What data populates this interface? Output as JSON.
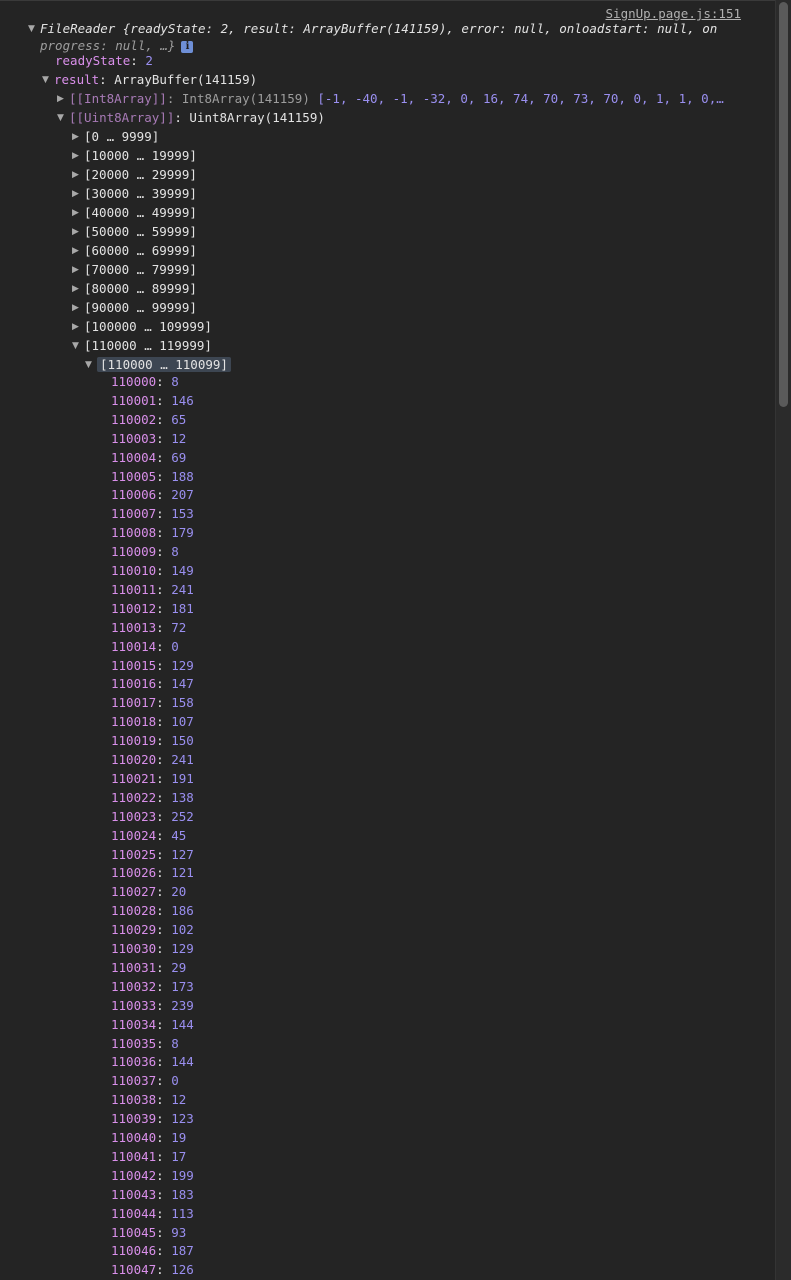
{
  "source_link": "SignUp.page.js:151",
  "filereader": {
    "line1": "FileReader {readyState: 2, result: ArrayBuffer(141159), error: null, onloadstart: null, on",
    "line2": "progress: null, …}",
    "info_icon": "i"
  },
  "ready_state": {
    "key": "readyState",
    "value": "2"
  },
  "result": {
    "key": "result",
    "value": "ArrayBuffer(141159)"
  },
  "int8": {
    "key": "[[Int8Array]]",
    "type": "Int8Array(141159)",
    "preview": "[-1, -40, -1, -32, 0, 16, 74, 70, 73, 70, 0, 1, 1, 0,…"
  },
  "uint8": {
    "key": "[[Uint8Array]]",
    "type": "Uint8Array(141159)"
  },
  "ranges": [
    "[0 … 9999]",
    "[10000 … 19999]",
    "[20000 … 29999]",
    "[30000 … 39999]",
    "[40000 … 49999]",
    "[50000 … 59999]",
    "[60000 … 69999]",
    "[70000 … 79999]",
    "[80000 … 89999]",
    "[90000 … 99999]",
    "[100000 … 109999]",
    "[110000 … 119999]"
  ],
  "subrange": "[110000 … 110099]",
  "entries": [
    {
      "index": "110000",
      "value": "8"
    },
    {
      "index": "110001",
      "value": "146"
    },
    {
      "index": "110002",
      "value": "65"
    },
    {
      "index": "110003",
      "value": "12"
    },
    {
      "index": "110004",
      "value": "69"
    },
    {
      "index": "110005",
      "value": "188"
    },
    {
      "index": "110006",
      "value": "207"
    },
    {
      "index": "110007",
      "value": "153"
    },
    {
      "index": "110008",
      "value": "179"
    },
    {
      "index": "110009",
      "value": "8"
    },
    {
      "index": "110010",
      "value": "149"
    },
    {
      "index": "110011",
      "value": "241"
    },
    {
      "index": "110012",
      "value": "181"
    },
    {
      "index": "110013",
      "value": "72"
    },
    {
      "index": "110014",
      "value": "0"
    },
    {
      "index": "110015",
      "value": "129"
    },
    {
      "index": "110016",
      "value": "147"
    },
    {
      "index": "110017",
      "value": "158"
    },
    {
      "index": "110018",
      "value": "107"
    },
    {
      "index": "110019",
      "value": "150"
    },
    {
      "index": "110020",
      "value": "241"
    },
    {
      "index": "110021",
      "value": "191"
    },
    {
      "index": "110022",
      "value": "138"
    },
    {
      "index": "110023",
      "value": "252"
    },
    {
      "index": "110024",
      "value": "45"
    },
    {
      "index": "110025",
      "value": "127"
    },
    {
      "index": "110026",
      "value": "121"
    },
    {
      "index": "110027",
      "value": "20"
    },
    {
      "index": "110028",
      "value": "186"
    },
    {
      "index": "110029",
      "value": "102"
    },
    {
      "index": "110030",
      "value": "129"
    },
    {
      "index": "110031",
      "value": "29"
    },
    {
      "index": "110032",
      "value": "173"
    },
    {
      "index": "110033",
      "value": "239"
    },
    {
      "index": "110034",
      "value": "144"
    },
    {
      "index": "110035",
      "value": "8"
    },
    {
      "index": "110036",
      "value": "144"
    },
    {
      "index": "110037",
      "value": "0"
    },
    {
      "index": "110038",
      "value": "12"
    },
    {
      "index": "110039",
      "value": "123"
    },
    {
      "index": "110040",
      "value": "19"
    },
    {
      "index": "110041",
      "value": "17"
    },
    {
      "index": "110042",
      "value": "199"
    },
    {
      "index": "110043",
      "value": "183"
    },
    {
      "index": "110044",
      "value": "113"
    },
    {
      "index": "110045",
      "value": "93"
    },
    {
      "index": "110046",
      "value": "187"
    },
    {
      "index": "110047",
      "value": "126"
    }
  ]
}
